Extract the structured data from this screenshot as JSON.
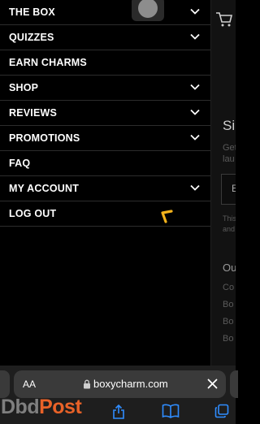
{
  "menu": {
    "items": [
      {
        "label": "THE BOX",
        "has_chevron": true
      },
      {
        "label": "QUIZZES",
        "has_chevron": true
      },
      {
        "label": "EARN CHARMS",
        "has_chevron": false
      },
      {
        "label": "SHOP",
        "has_chevron": true
      },
      {
        "label": "REVIEWS",
        "has_chevron": true
      },
      {
        "label": "PROMOTIONS",
        "has_chevron": true
      },
      {
        "label": "FAQ",
        "has_chevron": false
      },
      {
        "label": "MY ACCOUNT",
        "has_chevron": true
      },
      {
        "label": "LOG OUT",
        "has_chevron": false
      }
    ]
  },
  "background_page": {
    "title_fragment": "Si",
    "text_fragments": [
      "Get",
      "lau"
    ],
    "box_fragment": "E",
    "note_fragments": [
      "This",
      "and"
    ],
    "section_fragment": "Ou",
    "list_fragments": [
      "Co",
      "Bo",
      "Bo",
      "Bo"
    ]
  },
  "browser": {
    "text_size_label": "AA",
    "url": "boxycharm.com"
  },
  "watermark": {
    "part1": "Dbd",
    "part2": "Post"
  },
  "colors": {
    "accent_cursor": "#f2b21b",
    "background": "#000000",
    "divider": "#2c2c2c"
  }
}
